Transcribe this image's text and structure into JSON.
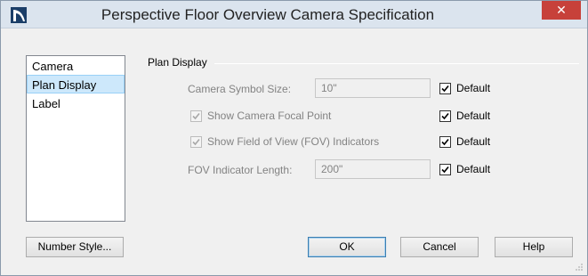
{
  "window": {
    "title": "Perspective Floor Overview Camera Specification",
    "close_glyph": "✕"
  },
  "nav": {
    "items": [
      {
        "label": "Camera",
        "selected": false
      },
      {
        "label": "Plan Display",
        "selected": true
      },
      {
        "label": "Label",
        "selected": false
      }
    ]
  },
  "panel": {
    "group_title": "Plan Display",
    "camera_symbol_size": {
      "label": "Camera Symbol Size:",
      "value": "10\"",
      "default_label": "Default",
      "default_checked": true
    },
    "show_focal_point": {
      "label": "Show Camera Focal Point",
      "checked": true,
      "enabled": false,
      "default_label": "Default",
      "default_checked": true
    },
    "show_fov": {
      "label": "Show Field of View (FOV) Indicators",
      "checked": true,
      "enabled": false,
      "default_label": "Default",
      "default_checked": true
    },
    "fov_length": {
      "label": "FOV Indicator Length:",
      "value": "200\"",
      "default_label": "Default",
      "default_checked": true
    }
  },
  "buttons": {
    "number_style": "Number Style...",
    "ok": "OK",
    "cancel": "Cancel",
    "help": "Help"
  },
  "colors": {
    "titlebar": "#dbe4ee",
    "close": "#c7413a",
    "selection": "#cde8fb",
    "disabled_text": "#838383"
  }
}
